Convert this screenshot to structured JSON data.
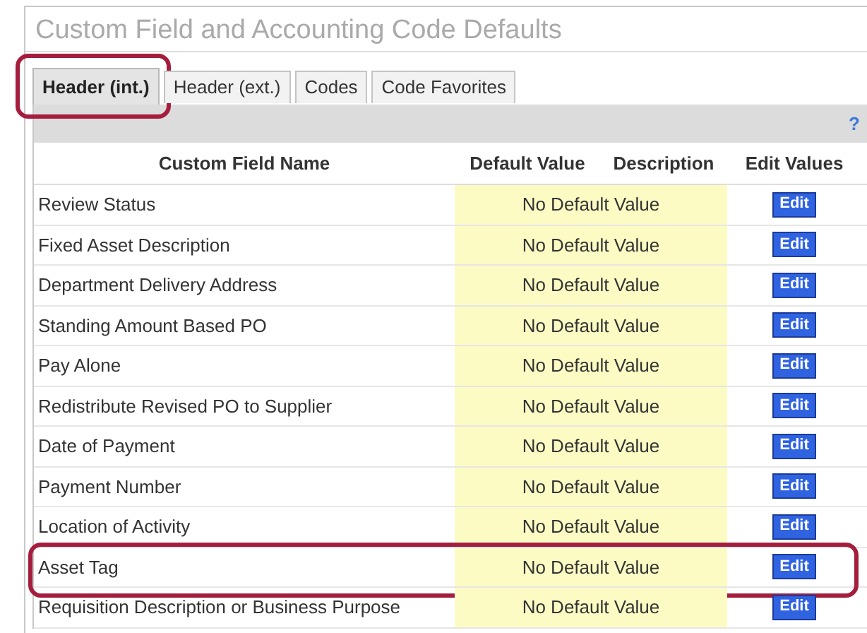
{
  "panel": {
    "title": "Custom Field and Accounting Code Defaults"
  },
  "tabs": [
    {
      "label": "Header (int.)",
      "selected": true,
      "highlighted": true
    },
    {
      "label": "Header (ext.)",
      "selected": false,
      "highlighted": false
    },
    {
      "label": "Codes",
      "selected": false,
      "highlighted": false
    },
    {
      "label": "Code Favorites",
      "selected": false,
      "highlighted": false
    }
  ],
  "toolbar": {
    "help": "?"
  },
  "table": {
    "columns": [
      "Custom Field Name",
      "Default Value",
      "Description",
      "Edit Values"
    ],
    "rows": [
      {
        "name": "Review Status",
        "default_value": "No Default Value",
        "action": "Edit",
        "highlighted": false
      },
      {
        "name": "Fixed Asset Description",
        "default_value": "No Default Value",
        "action": "Edit",
        "highlighted": false
      },
      {
        "name": "Department Delivery Address",
        "default_value": "No Default Value",
        "action": "Edit",
        "highlighted": false
      },
      {
        "name": "Standing Amount Based PO",
        "default_value": "No Default Value",
        "action": "Edit",
        "highlighted": false
      },
      {
        "name": "Pay Alone",
        "default_value": "No Default Value",
        "action": "Edit",
        "highlighted": false
      },
      {
        "name": "Redistribute Revised PO to Supplier",
        "default_value": "No Default Value",
        "action": "Edit",
        "highlighted": false
      },
      {
        "name": "Date of Payment",
        "default_value": "No Default Value",
        "action": "Edit",
        "highlighted": false
      },
      {
        "name": "Payment Number",
        "default_value": "No Default Value",
        "action": "Edit",
        "highlighted": false
      },
      {
        "name": "Location of Activity",
        "default_value": "No Default Value",
        "action": "Edit",
        "highlighted": false
      },
      {
        "name": "Asset Tag",
        "default_value": "No Default Value",
        "action": "Edit",
        "highlighted": true
      },
      {
        "name": "Requisition Description or Business Purpose",
        "default_value": "No Default Value",
        "action": "Edit",
        "highlighted": false
      }
    ]
  }
}
